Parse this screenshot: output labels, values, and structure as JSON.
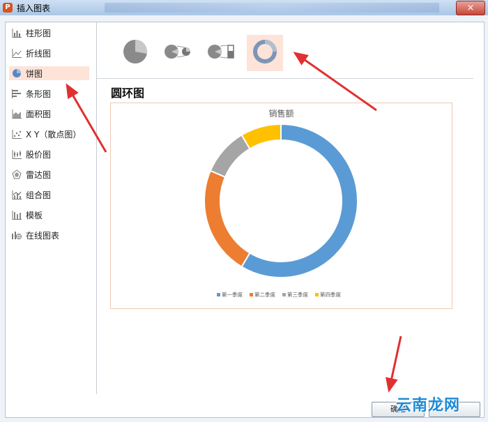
{
  "window": {
    "title": "插入图表",
    "close_glyph": "×"
  },
  "sidebar": {
    "items": [
      {
        "label": "柱形图",
        "icon": "column-chart-icon"
      },
      {
        "label": "折线图",
        "icon": "line-chart-icon"
      },
      {
        "label": "饼图",
        "icon": "pie-chart-icon",
        "selected": true
      },
      {
        "label": "条形图",
        "icon": "bar-chart-icon"
      },
      {
        "label": "面积图",
        "icon": "area-chart-icon"
      },
      {
        "label": "X Y（散点图）",
        "icon": "scatter-chart-icon"
      },
      {
        "label": "股价图",
        "icon": "stock-chart-icon"
      },
      {
        "label": "雷达图",
        "icon": "radar-chart-icon"
      },
      {
        "label": "组合图",
        "icon": "combo-chart-icon"
      },
      {
        "label": "模板",
        "icon": "template-icon"
      },
      {
        "label": "在线图表",
        "icon": "online-chart-icon"
      }
    ]
  },
  "chart_types": [
    {
      "icon": "pie-type-icon"
    },
    {
      "icon": "pie-of-pie-type-icon"
    },
    {
      "icon": "bar-of-pie-type-icon"
    },
    {
      "icon": "doughnut-type-icon",
      "selected": true
    }
  ],
  "selected_type_title": "圆环图",
  "chart_data": {
    "type": "pie",
    "subtype": "doughnut",
    "title": "销售额",
    "categories": [
      "第一季度",
      "第二季度",
      "第三季度",
      "第四季度"
    ],
    "values": [
      8.2,
      3.2,
      1.4,
      1.2
    ],
    "colors": [
      "#5b9bd5",
      "#ed7d31",
      "#a5a5a5",
      "#ffc000"
    ],
    "legend_position": "bottom"
  },
  "footer": {
    "ok_label": "确定"
  },
  "watermark": "云南龙网",
  "colors": {
    "accent_selected": "#fde3d8",
    "arrow": "#e03030"
  }
}
